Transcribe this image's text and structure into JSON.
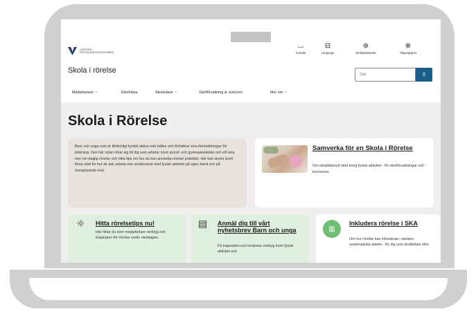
{
  "site": {
    "logo_text_line1": "VÄSTRA",
    "logo_text_line2": "GÖTALANDSREGIONEN",
    "title": "Skola i rörelse"
  },
  "top_links": [
    {
      "icon": "bookmark-icon",
      "glyph": "⌴",
      "label": "Kontakt"
    },
    {
      "icon": "language-icon",
      "glyph": "⊟",
      "label": "Language"
    },
    {
      "icon": "sitemap-icon",
      "glyph": "⊛",
      "label": "Webbplatskarta"
    },
    {
      "icon": "accessibility-icon",
      "glyph": "⊕",
      "label": "Tillgänglighet"
    }
  ],
  "search": {
    "placeholder": "Sök",
    "button_glyph": "⚲"
  },
  "nav": [
    {
      "label": "Medarbetare",
      "has_dropdown": true
    },
    {
      "label": "Elevhälsa",
      "has_dropdown": false
    },
    {
      "label": "Skolledare",
      "has_dropdown": true
    },
    {
      "label": "Skolförvaltning & -koncern",
      "has_dropdown": false
    },
    {
      "label": "Mer om",
      "has_dropdown": true
    }
  ],
  "page": {
    "heading": "Skola i Rörelse",
    "intro": "Barn och unga som är tillräckligt fysiskt aktiva mår bättre och förbättrar sina förutsättningar för inlärning. Den här sidan riktar sig till dig som arbetar inom grund- och gymnasieskolan och vill veta mer om daglig rörelse och hitta tips om hur du kan använda rörelse praktiskt. Här kan skolor även finna stöd för hur de kan arbeta mer strukturerat med fysisk aktivitet på egen hand och på övergripande nivå."
  },
  "cards": {
    "samverka": {
      "title": "Samverka för en Skola i Rörelse",
      "text": "Om skräddarsytt stöd kring fysisk aktivitet - för skolförvaltningar och -koncerner."
    },
    "tips": {
      "icon": "lightbulb-icon",
      "glyph": "☼",
      "title": "Hitta rörelsetips nu!",
      "text": "Här hittar du som medarbetare verktyg och inspiration för rörelse under skoldagen."
    },
    "newsletter": {
      "icon": "document-icon",
      "glyph": "▤",
      "title": "Anmäl dig till vårt nyhetsbrev Barn och unga",
      "text": "Få inspiration och konkreta verktyg inom fysisk aktivitet och"
    },
    "ska": {
      "icon": "chart-icon",
      "glyph": "▥",
      "title": "Inkludera rörelse i SKA",
      "text": "Om hur rörelse kan inkluderas i skolans systematiska arbete - för dig som skolledare eller"
    }
  },
  "colors": {
    "primary_button": "#1a5e8a",
    "card_green": "#dff0df",
    "content_bg": "#f1efed",
    "intro_bg": "#e7e2df"
  }
}
